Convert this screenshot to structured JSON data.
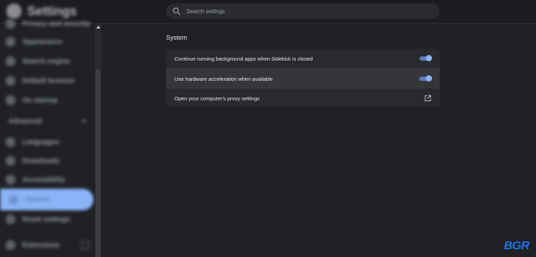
{
  "app": {
    "title": "Settings"
  },
  "search": {
    "placeholder": "Search settings"
  },
  "sidebar": {
    "items": [
      {
        "label": "Privacy and security"
      },
      {
        "label": "Appearance"
      },
      {
        "label": "Search engine"
      },
      {
        "label": "Default browser"
      },
      {
        "label": "On startup"
      }
    ],
    "advanced_label": "Advanced",
    "advanced_items": [
      {
        "label": "Languages"
      },
      {
        "label": "Downloads"
      },
      {
        "label": "Accessibility"
      },
      {
        "label": "System"
      },
      {
        "label": "Reset settings"
      }
    ],
    "footer_label": "Extensions"
  },
  "main": {
    "section_title": "System",
    "rows": [
      {
        "label": "Continue running background apps when Sidekick is closed",
        "toggle": true
      },
      {
        "label": "Use hardware acceleration when available",
        "toggle": true
      },
      {
        "label": "Open your computer's proxy settings",
        "external_link": true
      }
    ]
  },
  "watermark": {
    "text": "BGR"
  },
  "colors": {
    "accent": "#8ab4f8",
    "background": "#202124",
    "card": "#292a2d",
    "highlight_row": "#35363a",
    "watermark": "#1a73e8"
  }
}
